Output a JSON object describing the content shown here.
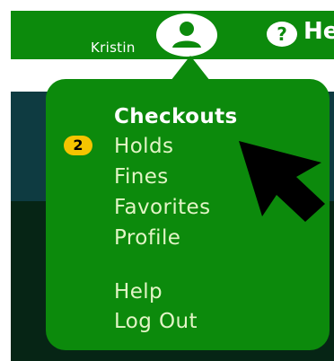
{
  "header": {
    "user_name": "Kristin",
    "help_label": "He"
  },
  "menu": {
    "items": [
      {
        "label": "Checkouts",
        "active": true
      },
      {
        "label": "Holds",
        "badge": "2"
      },
      {
        "label": "Fines"
      },
      {
        "label": "Favorites"
      },
      {
        "label": "Profile"
      },
      {
        "label": "Help"
      },
      {
        "label": "Log Out"
      }
    ]
  },
  "icons": {
    "avatar": "user-circle-icon",
    "help": "question-circle-icon",
    "cursor": "mouse-pointer-icon"
  },
  "colors": {
    "header_green": "#0c8a0c",
    "menu_green": "#0c8a0c",
    "menu_text": "#e2f5c6",
    "badge": "#f5c400",
    "page_dark": "#0e3b41"
  }
}
